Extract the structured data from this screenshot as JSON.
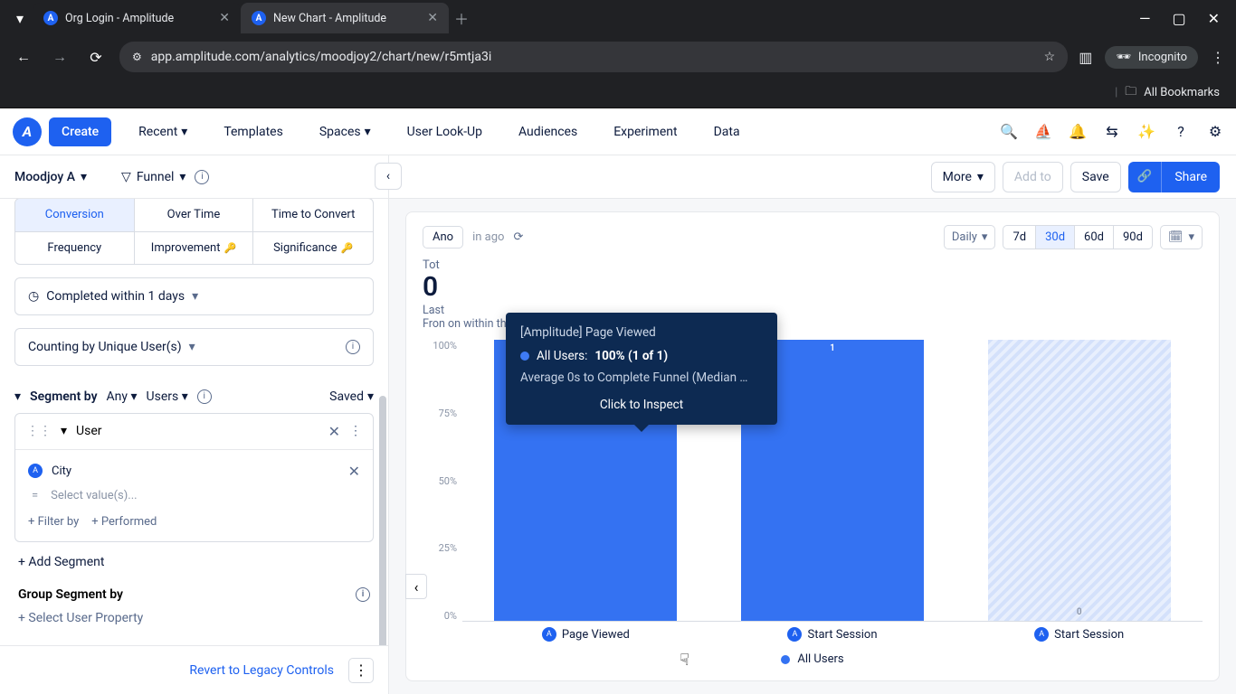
{
  "browser": {
    "tabs": [
      {
        "title": "Org Login - Amplitude",
        "active": false
      },
      {
        "title": "New Chart - Amplitude",
        "active": true
      }
    ],
    "url": "app.amplitude.com/analytics/moodjoy2/chart/new/r5mtja3i",
    "incognito_label": "Incognito",
    "all_bookmarks": "All Bookmarks"
  },
  "header": {
    "create": "Create",
    "nav": [
      "Recent",
      "Templates",
      "Spaces",
      "User Look-Up",
      "Audiences",
      "Experiment",
      "Data"
    ]
  },
  "sidebar": {
    "project": "Moodjoy A",
    "chart_type": "Funnel",
    "metric_tabs": {
      "conversion": "Conversion",
      "over_time": "Over Time",
      "time_to_convert": "Time to Convert",
      "frequency": "Frequency",
      "improvement": "Improvement",
      "significance": "Significance"
    },
    "completed_within": "Completed within 1 days",
    "counting_by": "Counting by Unique User(s)",
    "segment_by": {
      "title": "Segment by",
      "any": "Any",
      "users": "Users",
      "saved": "Saved"
    },
    "segment": {
      "name": "User",
      "property": "City",
      "operator": "=",
      "value_placeholder": "Select value(s)...",
      "filter_by": "+ Filter by",
      "performed": "+ Performed"
    },
    "add_segment": "+ Add Segment",
    "group_segment_by": "Group Segment by",
    "select_user_property": "+ Select User Property",
    "revert": "Revert to Legacy Controls"
  },
  "main_toolbar": {
    "more": "More",
    "add_to": "Add to",
    "save": "Save",
    "share": "Share"
  },
  "chart_data": {
    "type": "bar",
    "title": "[Amplitude] Page Viewed",
    "categories": [
      "Page Viewed",
      "Start Session",
      "Start Session"
    ],
    "values": [
      100,
      100,
      0
    ],
    "bar_labels": [
      "1",
      "1",
      "0"
    ],
    "ylabel_ticks": [
      "100%",
      "75%",
      "50%",
      "25%",
      "0%"
    ],
    "ylim": [
      0,
      100
    ],
    "series_name": "All Users",
    "tooltip": {
      "title": "[Amplitude] Page Viewed",
      "series": "All Users:",
      "value": "100% (1 of 1)",
      "avg": "Average 0s to Complete Funnel (Median …",
      "inspect": "Click to Inspect"
    }
  },
  "chart_meta": {
    "anchor_label": "Ano",
    "refreshed": "in ago",
    "granularity": "Daily",
    "ranges": [
      "7d",
      "30d",
      "60d",
      "90d"
    ],
    "active_range": "30d",
    "summary_label": "Tot",
    "summary_value": "0",
    "summary_sub_prefix": "Last",
    "summary_sub_from": "Fron",
    "summary_sub_within": "on within the last 30 days."
  }
}
